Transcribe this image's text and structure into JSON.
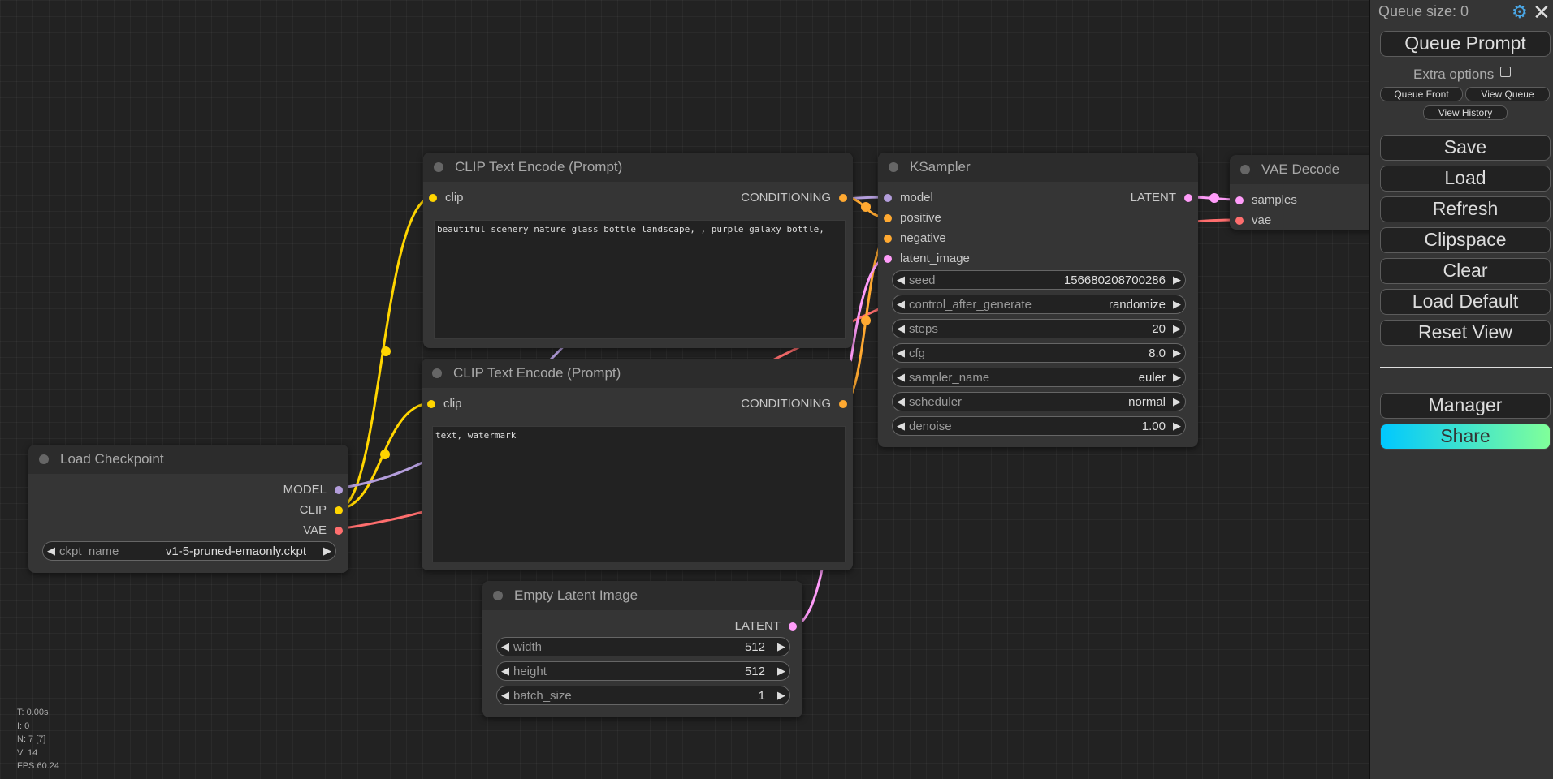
{
  "nodes": {
    "clip_pos": {
      "title": "CLIP Text Encode (Prompt)",
      "input": "clip",
      "output": "CONDITIONING",
      "text": "beautiful scenery nature glass bottle landscape, , purple galaxy bottle,"
    },
    "clip_neg": {
      "title": "CLIP Text Encode (Prompt)",
      "input": "clip",
      "output": "CONDITIONING",
      "text": "text, watermark"
    },
    "ksampler": {
      "title": "KSampler",
      "inputs": [
        "model",
        "positive",
        "negative",
        "latent_image"
      ],
      "output": "LATENT",
      "widgets": [
        {
          "name": "seed",
          "value": "156680208700286"
        },
        {
          "name": "control_after_generate",
          "value": "randomize"
        },
        {
          "name": "steps",
          "value": "20"
        },
        {
          "name": "cfg",
          "value": "8.0"
        },
        {
          "name": "sampler_name",
          "value": "euler"
        },
        {
          "name": "scheduler",
          "value": "normal"
        },
        {
          "name": "denoise",
          "value": "1.00"
        }
      ]
    },
    "vae_decode": {
      "title": "VAE Decode",
      "inputs": [
        "samples",
        "vae"
      ]
    },
    "load_checkpoint": {
      "title": "Load Checkpoint",
      "outputs": [
        "MODEL",
        "CLIP",
        "VAE"
      ],
      "widget": {
        "name": "ckpt_name",
        "value": "v1-5-pruned-emaonly.ckpt"
      }
    },
    "empty_latent": {
      "title": "Empty Latent Image",
      "output": "LATENT",
      "widgets": [
        {
          "name": "width",
          "value": "512"
        },
        {
          "name": "height",
          "value": "512"
        },
        {
          "name": "batch_size",
          "value": "1"
        }
      ]
    }
  },
  "stats": {
    "time": "T: 0.00s",
    "i": "I: 0",
    "n": "N: 7 [7]",
    "v": "V: 14",
    "fps": "FPS:60.24"
  },
  "menu": {
    "queue_size": "Queue size: 0",
    "settings_icon": "gear-icon",
    "close_icon": "close-icon",
    "queue_prompt": "Queue Prompt",
    "extra_options": "Extra options",
    "queue_front": "Queue Front",
    "view_queue": "View Queue",
    "view_history": "View History",
    "save": "Save",
    "load": "Load",
    "refresh": "Refresh",
    "clipspace": "Clipspace",
    "clear": "Clear",
    "load_default": "Load Default",
    "reset_view": "Reset View",
    "manager": "Manager",
    "share": "Share"
  },
  "colors": {
    "clip": "#ffd500",
    "conditioning": "#ffa931",
    "model": "#b39ddb",
    "vae": "#ff6e6e",
    "latent": "#ff9cf9",
    "share_gradient_start": "#00c8ff",
    "share_gradient_end": "#80ff9a"
  }
}
